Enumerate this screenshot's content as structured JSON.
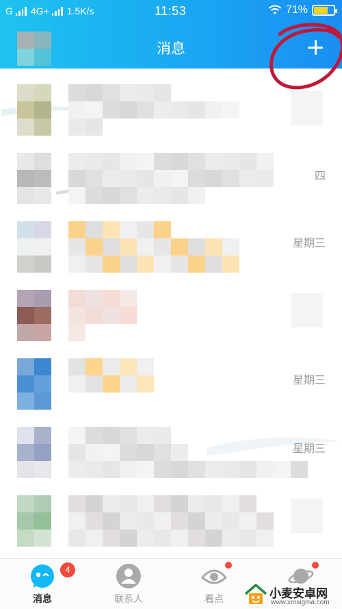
{
  "status_bar": {
    "carrier": "G",
    "network": "4G+",
    "speed": "1.5K/s",
    "time": "11:53",
    "battery": "71%",
    "battery_level": 0.71,
    "icons": [
      "signal-icon",
      "signal-icon",
      "wifi-icon",
      "battery-icon"
    ]
  },
  "header": {
    "title": "消息",
    "add_button_icon": "plus-icon",
    "annotation_color": "#c0183a"
  },
  "messages": [
    {
      "time": "",
      "avatar_colors": [
        "#a8b2b4",
        "#88b6bc",
        "#7ed3dc",
        "#54c3d8"
      ]
    },
    {
      "time": "",
      "avatar_colors": [
        "#dcdcc8",
        "#d6d8bc",
        "#c8c49a",
        "#b4b48c",
        "#e0dccc",
        "#c8c8a8"
      ]
    },
    {
      "time": "四",
      "avatar_colors": [
        "#e8e8e8",
        "#dedede",
        "#b8b8b8",
        "#bcbcbc",
        "#e4e4e4",
        "#e8e8e8"
      ]
    },
    {
      "time": "星期三",
      "avatar_colors": [
        "#d2e0ec",
        "#d6d8e8",
        "#ecf2f2",
        "#f0f0f0",
        "#d0d0cc",
        "#c8c8c4"
      ]
    },
    {
      "time": "",
      "avatar_colors": [
        "#b4a4b4",
        "#a89cb0",
        "#8c5c54",
        "#9c6c60",
        "#c0a8a8",
        "#c8a4a4"
      ]
    },
    {
      "time": "星期三",
      "avatar_colors": [
        "#78a8d8",
        "#3c88d0",
        "#4c90d4",
        "#64a0dc",
        "#7cb0e0",
        "#5c98d4"
      ]
    },
    {
      "time": "星期三",
      "avatar_colors": [
        "#dfe2ec",
        "#a8b2cc",
        "#a8b2cc",
        "#94a0c4",
        "#e4e4e8",
        "#e8e8ec"
      ]
    },
    {
      "time": "",
      "avatar_colors": [
        "#c0d8c4",
        "#b0ccb4",
        "#a4c8a8",
        "#94c09c",
        "#c4dcc4",
        "#d4e4d4"
      ]
    }
  ],
  "tabs": [
    {
      "label": "消息",
      "icon": "message-bubble-icon",
      "badge": "4",
      "active": true
    },
    {
      "label": "联系人",
      "icon": "contacts-icon",
      "badge": "",
      "active": false
    },
    {
      "label": "看点",
      "icon": "eye-icon",
      "badge": "",
      "active": false
    },
    {
      "label": "",
      "icon": "planet-icon",
      "badge": "",
      "active": false
    }
  ],
  "watermark": {
    "title": "小麦安卓网",
    "url": "www.xmsigma.com"
  },
  "colors": {
    "header_gradient_start": "#1ec3f0",
    "header_gradient_end": "#1a8ff2",
    "badge_red": "#f04a3a",
    "time_gray": "#9a9a9a"
  }
}
